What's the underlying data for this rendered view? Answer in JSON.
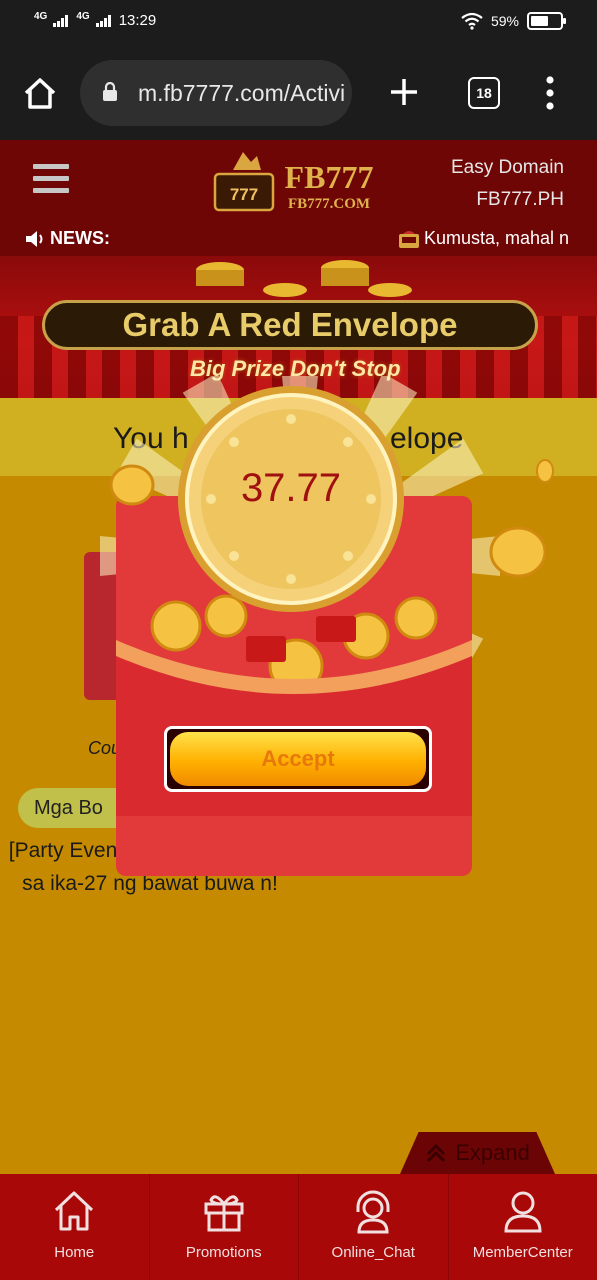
{
  "status_bar": {
    "network1": "4G",
    "network2": "4G",
    "time": "13:29",
    "battery": "59%",
    "battery_level": 0.59
  },
  "browser": {
    "url": "m.fb7777.com/Activiti",
    "tab_count": "18",
    "home_icon": "home-icon",
    "lock_icon": "lock-icon",
    "new_tab_icon": "plus-icon",
    "menu_icon": "more-vert-icon"
  },
  "header": {
    "logo_main": "FB777",
    "logo_sub": "FB777.COM",
    "logo_slot": "777",
    "domain_line1": "Easy Domain",
    "domain_line2": "FB777.PH",
    "news_label": "NEWS:",
    "ticker_text": "Kumusta, mahal n"
  },
  "banner": {
    "title": "Grab A Red Envelope",
    "subtitle": "Big Prize Don't Stop"
  },
  "page": {
    "you_text_left": "You h",
    "you_text_right": "elope",
    "count_label": "Cou",
    "bonus_chip": "Mga Bo",
    "description": "[Party Event Bonus] Ibinaha gi sa ika-27 ng bawat buwa n!",
    "expand_label": "Expand"
  },
  "popup": {
    "amount": "37.77",
    "accept_label": "Accept"
  },
  "bottom_nav": [
    {
      "label": "Home",
      "icon": "home-icon"
    },
    {
      "label": "Promotions",
      "icon": "gift-icon"
    },
    {
      "label": "Online_Chat",
      "icon": "headset-icon"
    },
    {
      "label": "MemberCenter",
      "icon": "user-icon"
    }
  ],
  "colors": {
    "header_bg": "#6e0606",
    "content_bg": "#c58a00",
    "nav_bg": "#a80808",
    "accept_text": "#e8780c",
    "amount_text": "#a11010"
  }
}
